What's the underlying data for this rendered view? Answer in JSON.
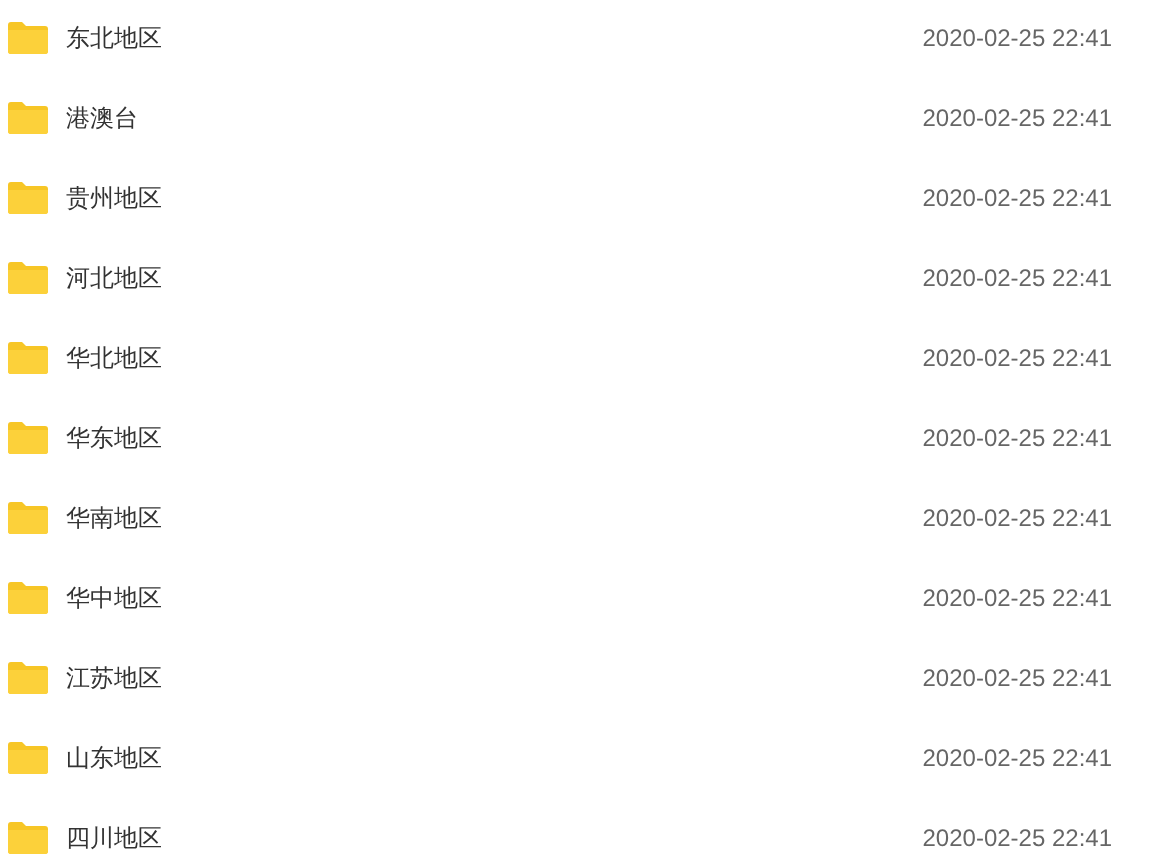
{
  "files": [
    {
      "name": "东北地区",
      "modified": "2020-02-25 22:41"
    },
    {
      "name": "港澳台",
      "modified": "2020-02-25 22:41"
    },
    {
      "name": "贵州地区",
      "modified": "2020-02-25 22:41"
    },
    {
      "name": "河北地区",
      "modified": "2020-02-25 22:41"
    },
    {
      "name": "华北地区",
      "modified": "2020-02-25 22:41"
    },
    {
      "name": "华东地区",
      "modified": "2020-02-25 22:41"
    },
    {
      "name": "华南地区",
      "modified": "2020-02-25 22:41"
    },
    {
      "name": "华中地区",
      "modified": "2020-02-25 22:41"
    },
    {
      "name": "江苏地区",
      "modified": "2020-02-25 22:41"
    },
    {
      "name": "山东地区",
      "modified": "2020-02-25 22:41"
    },
    {
      "name": "四川地区",
      "modified": "2020-02-25 22:41"
    }
  ]
}
